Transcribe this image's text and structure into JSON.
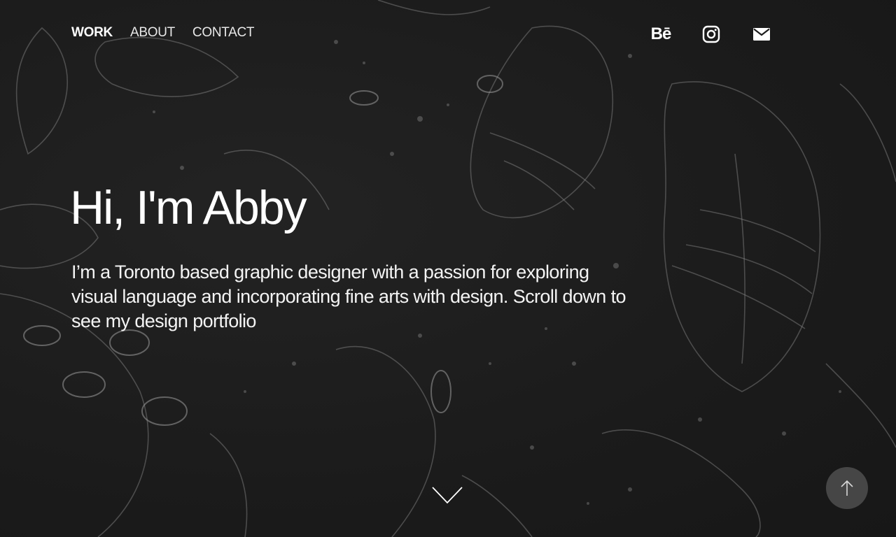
{
  "nav": {
    "items": [
      {
        "label": "WORK",
        "active": true
      },
      {
        "label": "ABOUT",
        "active": false
      },
      {
        "label": "CONTACT",
        "active": false
      }
    ]
  },
  "social": {
    "behance_label": "Bē",
    "icons": [
      "behance-icon",
      "instagram-icon",
      "mail-icon"
    ]
  },
  "hero": {
    "title": "Hi, I'm Abby",
    "text": "I’m a Toronto based graphic designer with a passion for exploring visual language and incorporating fine arts with design. Scroll down to see my design portfolio"
  },
  "controls": {
    "scroll_icon": "chevron-down-icon",
    "top_icon": "arrow-up-icon"
  },
  "colors": {
    "background": "#1d1d1d",
    "text": "#ffffff",
    "texture_stroke": "#8a8a8a"
  }
}
